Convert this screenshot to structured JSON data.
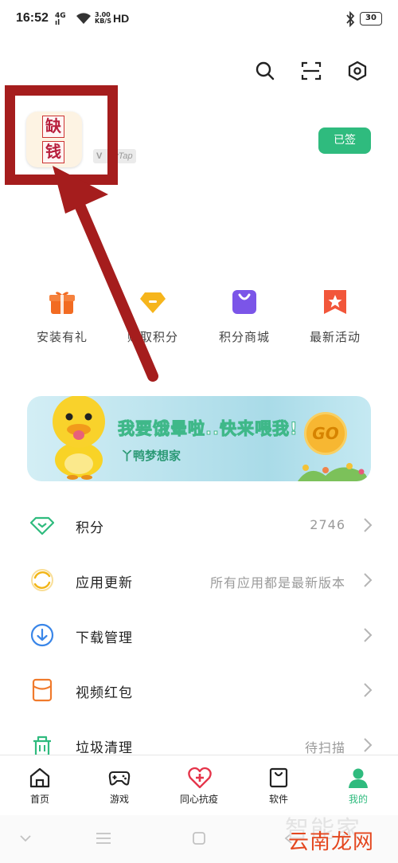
{
  "status_bar": {
    "time": "16:52",
    "network": "4G",
    "network_sub": "ıl",
    "speed_value": "3.00",
    "speed_unit": "KB/S",
    "hd": "HD",
    "battery": "30"
  },
  "top_bar": {
    "icons": [
      "search-icon",
      "scan-icon",
      "settings-icon"
    ]
  },
  "profile": {
    "app_icon_chars": [
      "缺",
      "钱"
    ],
    "badge_text": "eyTap",
    "badge_logo": "V",
    "signed_button": "已签"
  },
  "quick_actions": [
    {
      "label": "安装有礼",
      "icon": "gift-icon",
      "color": "#f26b22"
    },
    {
      "label": "赚取积分",
      "icon": "diamond-icon",
      "color": "#f6b51c"
    },
    {
      "label": "积分商城",
      "icon": "shopping-bag-icon",
      "color": "#7b55e8"
    },
    {
      "label": "最新活动",
      "icon": "event-star-icon",
      "color": "#f2563a"
    }
  ],
  "banner": {
    "title": "我要饿晕啦..快来喂我!",
    "subtitle": "丫鸭梦想家",
    "coin_text": "GO"
  },
  "menu_items": [
    {
      "label": "积分",
      "value": "2746",
      "icon": "points-diamond-icon"
    },
    {
      "label": "应用更新",
      "value": "所有应用都是最新版本",
      "icon": "refresh-icon"
    },
    {
      "label": "下载管理",
      "value": "",
      "icon": "download-icon"
    },
    {
      "label": "视频红包",
      "value": "",
      "icon": "red-envelope-icon"
    },
    {
      "label": "垃圾清理",
      "value": "待扫描",
      "icon": "trash-icon"
    }
  ],
  "tabs": [
    {
      "label": "首页",
      "icon": "home-icon",
      "active": false
    },
    {
      "label": "游戏",
      "icon": "gamepad-icon",
      "active": false
    },
    {
      "label": "同心抗疫",
      "icon": "heart-plus-icon",
      "active": false
    },
    {
      "label": "软件",
      "icon": "software-bag-icon",
      "active": false
    },
    {
      "label": "我的",
      "icon": "profile-icon",
      "active": true
    }
  ],
  "colors": {
    "accent": "#2fbb7e",
    "highlight": "#a51d1d",
    "watermark": "#e4471f"
  },
  "watermark": {
    "back_text": "智能家",
    "front_text": "云南龙网"
  }
}
